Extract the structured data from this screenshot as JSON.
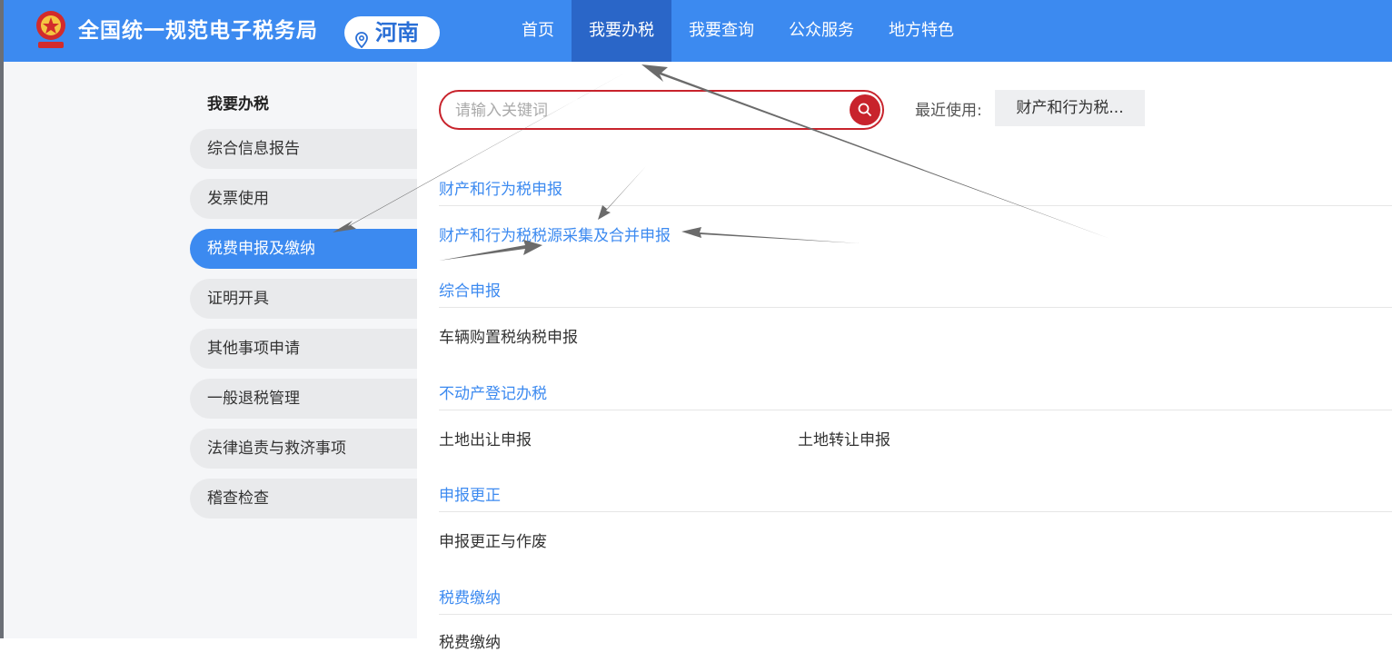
{
  "header": {
    "site_title": "全国统一规范电子税务局",
    "region": "河南",
    "nav": [
      "首页",
      "我要办税",
      "我要查询",
      "公众服务",
      "地方特色"
    ],
    "active_nav": "我要办税"
  },
  "sidebar": {
    "title": "我要办税",
    "items": [
      {
        "label": "综合信息报告"
      },
      {
        "label": "发票使用"
      },
      {
        "label": "税费申报及缴纳"
      },
      {
        "label": "证明开具"
      },
      {
        "label": "其他事项申请"
      },
      {
        "label": "一般退税管理"
      },
      {
        "label": "法律追责与救济事项"
      },
      {
        "label": "稽查检查"
      }
    ],
    "active_item": "税费申报及缴纳"
  },
  "search": {
    "placeholder": "请输入关键词",
    "recent_label": "最近使用:",
    "recent_chip": "财产和行为税..."
  },
  "sections": [
    {
      "title": "财产和行为税申报",
      "items": [
        "财产和行为税税源采集及合并申报"
      ]
    },
    {
      "title": "综合申报",
      "items": [
        "车辆购置税纳税申报"
      ]
    },
    {
      "title": "不动产登记办税",
      "items": [
        "土地出让申报",
        "土地转让申报"
      ]
    },
    {
      "title": "申报更正",
      "items": [
        "申报更正与作废"
      ]
    },
    {
      "title": "税费缴纳",
      "items": [
        "税费缴纳"
      ]
    }
  ],
  "colors": {
    "header_bg": "#3c8af0",
    "active_nav_bg": "#2a66c8",
    "search_border": "#c8232c",
    "link": "#3c8af0"
  }
}
